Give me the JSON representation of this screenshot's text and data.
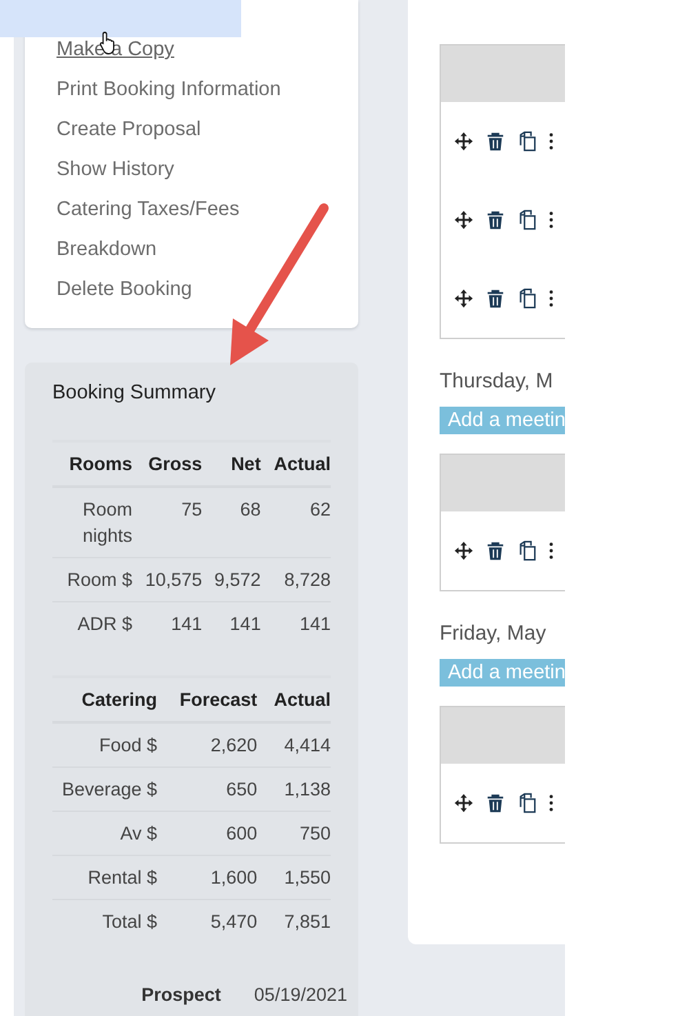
{
  "menu": {
    "items": [
      {
        "label": "Make a Copy",
        "hovered": true
      },
      {
        "label": "Print Booking Information",
        "hovered": false
      },
      {
        "label": "Create Proposal",
        "hovered": false
      },
      {
        "label": "Show History",
        "hovered": false
      },
      {
        "label": "Catering Taxes/Fees",
        "hovered": false
      },
      {
        "label": "Breakdown",
        "hovered": false
      },
      {
        "label": "Delete Booking",
        "hovered": false
      }
    ]
  },
  "booking_summary": {
    "title": "Booking Summary",
    "rooms_table": {
      "columns": [
        "Rooms",
        "Gross",
        "Net",
        "Actual"
      ],
      "rows": [
        [
          "Room nights",
          "75",
          "68",
          "62"
        ],
        [
          "Room $",
          "10,575",
          "9,572",
          "8,728"
        ],
        [
          "ADR $",
          "141",
          "141",
          "141"
        ]
      ]
    },
    "catering_table": {
      "columns": [
        "Catering",
        "Forecast",
        "Actual"
      ],
      "rows": [
        [
          "Food $",
          "2,620",
          "4,414"
        ],
        [
          "Beverage $",
          "650",
          "1,138"
        ],
        [
          "Av $",
          "600",
          "750"
        ],
        [
          "Rental $",
          "1,600",
          "1,550"
        ],
        [
          "Total $",
          "5,470",
          "7,851"
        ]
      ]
    },
    "status": {
      "label": "Prospect",
      "date": "05/19/2021"
    }
  },
  "schedule": [
    {
      "rows": [
        {
          "kind": "actions"
        },
        {
          "kind": "actions"
        },
        {
          "kind": "actions"
        }
      ]
    },
    {
      "day": "Thursday, M",
      "button": "Add a meetin",
      "rows": [
        {
          "kind": "actions"
        }
      ]
    },
    {
      "day": "Friday, May",
      "button": "Add a meetin",
      "rows": [
        {
          "kind": "actions"
        }
      ]
    }
  ]
}
